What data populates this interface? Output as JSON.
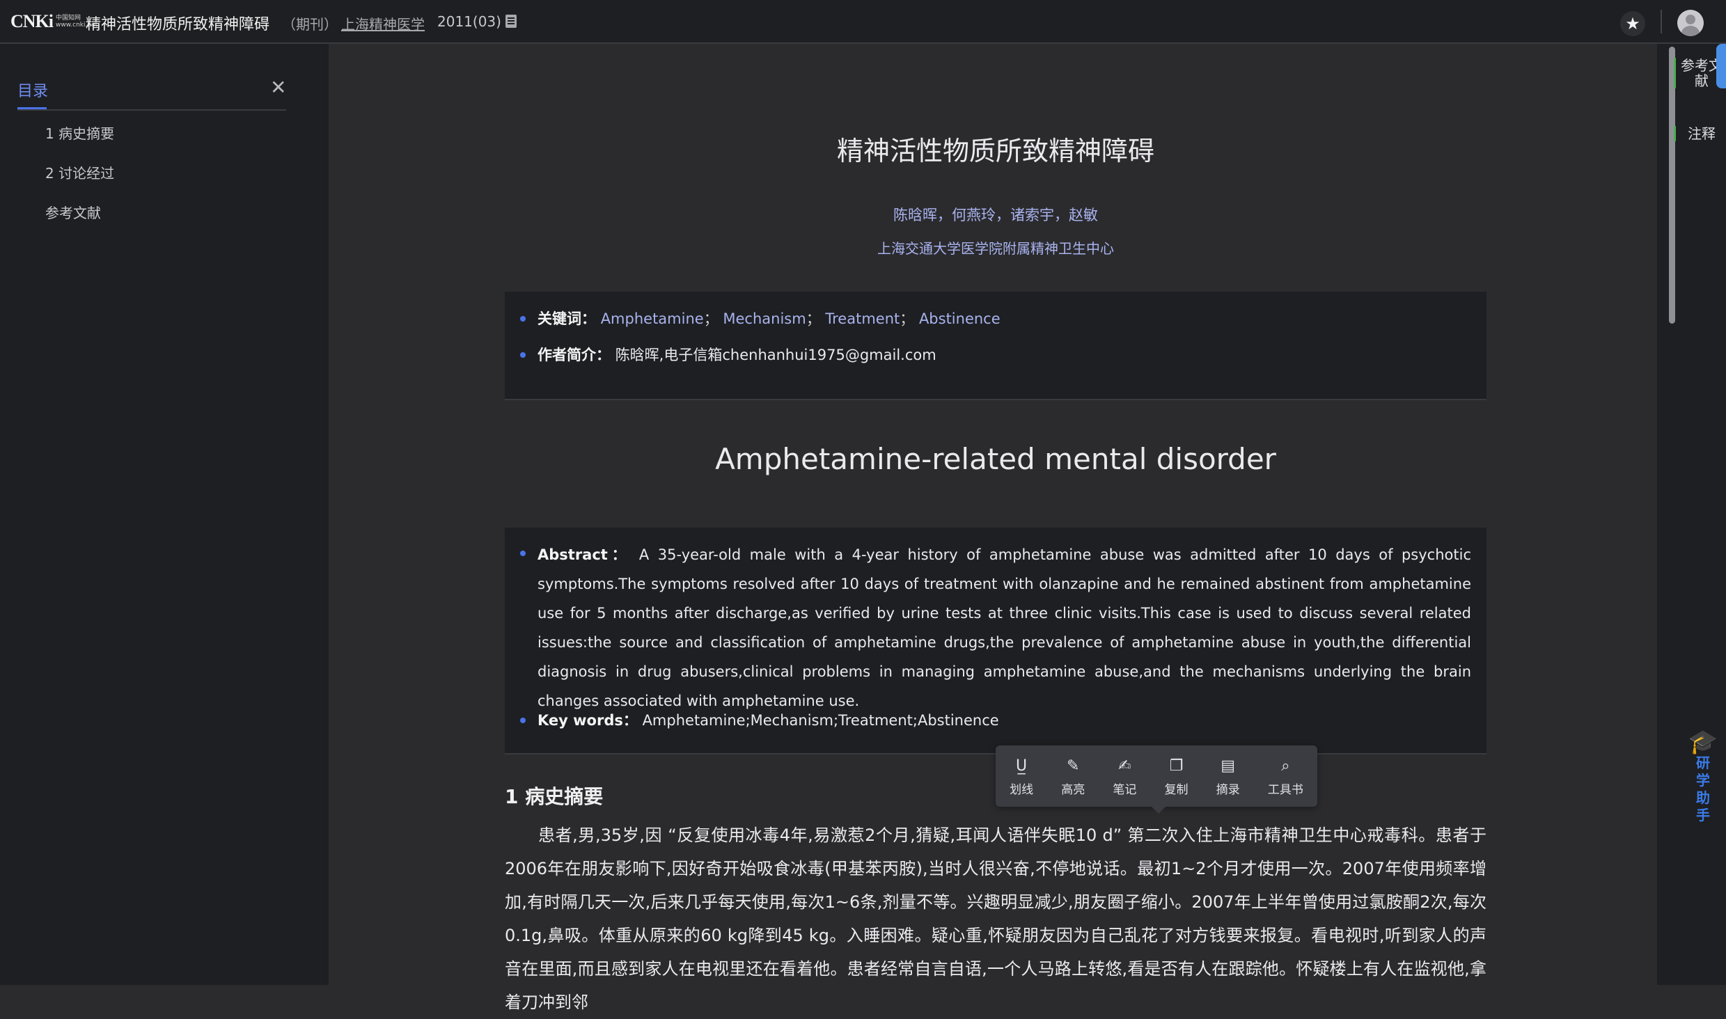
{
  "header": {
    "logo_text": "CNKi",
    "logo_cn": "中国知网",
    "logo_url": "www.cnki.net",
    "doc_title": "精神活性物质所致精神障碍",
    "doc_type": "（期刊）",
    "journal": "上海精神医学",
    "issue": "2011(03)"
  },
  "sidebar": {
    "title": "目录",
    "items": [
      {
        "label": "1 病史摘要"
      },
      {
        "label": "2 讨论经过"
      },
      {
        "label": "参考文献"
      }
    ]
  },
  "article": {
    "title": "精神活性物质所致精神障碍",
    "authors": "陈晗晖，何燕玲，诸索宇，赵敏",
    "affiliation": "上海交通大学医学院附属精神卫生中心",
    "keywords_label": "关键词：",
    "keywords": [
      "Amphetamine",
      "Mechanism",
      "Treatment",
      "Abstinence"
    ],
    "keyword_sep": "；",
    "author_intro_label": "作者简介：",
    "author_intro": "陈晗晖,电子信箱chenhanhui1975@gmail.com",
    "en_title": "Amphetamine-related mental disorder",
    "abstract_label": "Abstract：",
    "abstract": "A 35-year-old male with a 4-year history of amphetamine abuse was admitted after 10 days of psychotic symptoms.The symptoms resolved after 10 days of treatment with olanzapine and he remained abstinent from amphetamine use for 5 months after discharge,as verified by urine tests at three clinic visits.This case is used to discuss several related issues:the source and classification of amphetamine drugs,the prevalence of amphetamine abuse in youth,the differential diagnosis in drug abusers,clinical problems in managing amphetamine abuse,and the mechanisms underlying the brain changes associated with amphetamine use.",
    "en_keywords_label": "Key words：",
    "en_keywords": "Amphetamine;Mechanism;Treatment;Abstinence",
    "section1_title": "1 病史摘要",
    "section1_text": "患者,男,35岁,因 “反复使用冰毒4年,易激惹2个月,猜疑,耳闻人语伴失眠10 d” 第二次入住上海市精神卫生中心戒毒科。患者于2006年在朋友影响下,因好奇开始吸食冰毒(甲基苯丙胺),当时人很兴奋,不停地说话。最初1~2个月才使用一次。2007年使用频率增加,有时隔几天一次,后来几乎每天使用,每次1~6条,剂量不等。兴趣明显减少,朋友圈子缩小。2007年上半年曾使用过氯胺酮2次,每次0.1g,鼻吸。体重从原来的60 kg降到45 kg。入睡困难。疑心重,怀疑朋友因为自己乱花了对方钱要来报复。看电视时,听到家人的声音在里面,而且感到家人在电视里还在看着他。患者经常自言自语,一个人马路上转悠,看是否有人在跟踪他。怀疑楼上有人在监视他,拿着刀冲到邻"
  },
  "toolbar": {
    "items": [
      {
        "icon": "underline-icon",
        "label": "划线"
      },
      {
        "icon": "highlight-icon",
        "label": "高亮"
      },
      {
        "icon": "note-icon",
        "label": "笔记"
      },
      {
        "icon": "copy-icon",
        "label": "复制"
      },
      {
        "icon": "excerpt-icon",
        "label": "摘录"
      },
      {
        "icon": "reference-book-icon",
        "label": "工具书"
      }
    ]
  },
  "rightrail": {
    "references": "参考文献",
    "notes": "注释",
    "assistant": "研学助手"
  },
  "colors": {
    "accent": "#4a73ea",
    "link": "#a9b3ee",
    "assistant": "#3a7be8"
  }
}
